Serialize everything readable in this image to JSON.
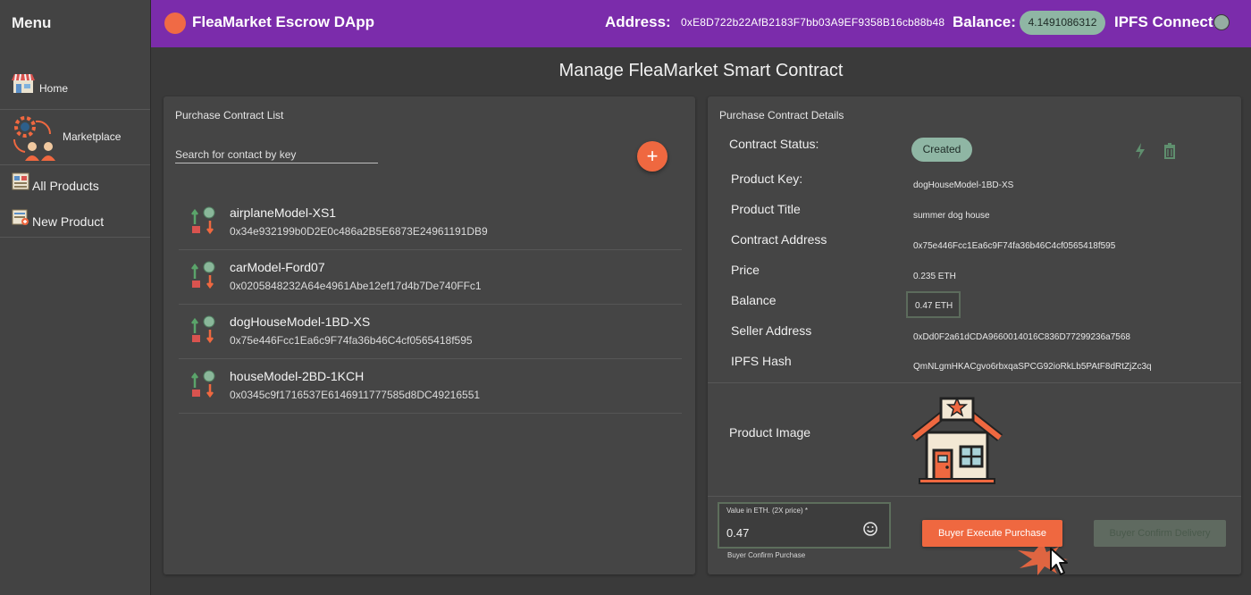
{
  "sidebar": {
    "title": "Menu",
    "items": [
      {
        "label": "Home",
        "icon": "shop-icon"
      },
      {
        "label": "Marketplace",
        "icon": "marketplace-gear-people-icon"
      },
      {
        "label": "All Products",
        "icon": "product-list-icon"
      },
      {
        "label": "New Product",
        "icon": "new-product-icon"
      }
    ]
  },
  "header": {
    "app_title": "FleaMarket Escrow DApp",
    "address_label": "Address:",
    "address_value": "0xE8D722b22AfB2183F7bb03A9EF9358B16cb88b48",
    "balance_label": "Balance:",
    "balance_value": "4.1491086312",
    "ipfs_label": "IPFS Connect:"
  },
  "page_title": "Manage FleaMarket Smart Contract",
  "contract_list": {
    "title": "Purchase Contract List",
    "search_placeholder": "Search for contact by key",
    "add_button": "+",
    "items": [
      {
        "key": "airplaneModel-XS1",
        "address": "0x34e932199b0D2E0c486a2B5E6873E24961191DB9"
      },
      {
        "key": "carModel-Ford07",
        "address": "0x0205848232A64e4961Abe12ef17d4b7De740FFc1"
      },
      {
        "key": "dogHouseModel-1BD-XS",
        "address": "0x75e446Fcc1Ea6c9F74fa36b46C4cf0565418f595"
      },
      {
        "key": "houseModel-2BD-1KCH",
        "address": "0x0345c9f1716537E6146911777585d8DC49216551"
      }
    ]
  },
  "details": {
    "title": "Purchase Contract Details",
    "status_label": "Contract Status:",
    "status_value": "Created",
    "product_key_label": "Product Key:",
    "product_key_value": "dogHouseModel-1BD-XS",
    "product_title_label": "Product Title",
    "product_title_value": "summer dog house",
    "contract_address_label": "Contract Address",
    "contract_address_value": "0x75e446Fcc1Ea6c9F74fa36b46C4cf0565418f595",
    "price_label": "Price",
    "price_value": "0.235 ETH",
    "balance_label": "Balance",
    "balance_value": "0.47 ETH",
    "seller_label": "Seller Address",
    "seller_value": "0xDd0F2a61dCDA9660014016C836D77299236a7568",
    "ipfs_label": "IPFS Hash",
    "ipfs_value": "QmNLgmHKACgvo6rbxqaSPCG92ioRkLb5PAtF8dRtZjZc3q",
    "image_label": "Product Image",
    "value_field_label": "Value in ETH. (2X price) *",
    "value_field_value": "0.47",
    "value_field_helper": "Buyer Confirm Purchase",
    "execute_button": "Buyer Execute Purchase",
    "confirm_button": "Buyer Confirm Delivery"
  },
  "colors": {
    "header": "#7b2cab",
    "accent": "#ef6840",
    "chip": "#8fb6a4",
    "panel": "#454545",
    "background": "#3a3a3a"
  }
}
